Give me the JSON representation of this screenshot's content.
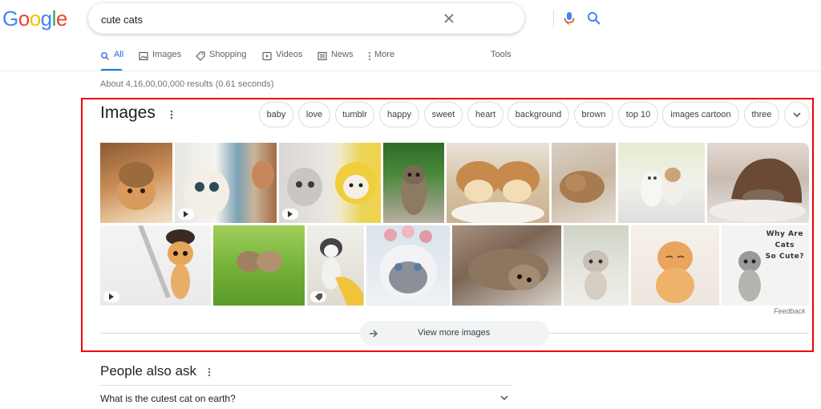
{
  "logo": {
    "letters": [
      "G",
      "o",
      "o",
      "g",
      "l",
      "e"
    ],
    "colors": [
      "#4285F4",
      "#EA4335",
      "#FBBC05",
      "#4285F4",
      "#34A853",
      "#EA4335"
    ]
  },
  "search": {
    "value": "cute cats",
    "icons": [
      "close-icon",
      "mic-icon",
      "search-icon"
    ]
  },
  "tabs": [
    {
      "label": "All",
      "icon": "search-icon"
    },
    {
      "label": "Images",
      "icon": "image-icon"
    },
    {
      "label": "Shopping",
      "icon": "tag-icon"
    },
    {
      "label": "Videos",
      "icon": "play-icon"
    },
    {
      "label": "News",
      "icon": "news-icon"
    },
    {
      "label": "More",
      "icon": "more-vert-icon"
    }
  ],
  "tools_label": "Tools",
  "result_stats": "About 4,16,00,00,000 results (0.61 seconds)",
  "images_section": {
    "title": "Images",
    "chips": [
      "baby",
      "love",
      "tumblr",
      "happy",
      "sweet",
      "heart",
      "background",
      "brown",
      "top 10",
      "images cartoon",
      "three"
    ],
    "thumb_overlay_text": [
      "Why Are",
      "Cats",
      "So Cute?"
    ],
    "feedback": "Feedback",
    "view_more": "View more images"
  },
  "people_also_ask": {
    "title": "People also ask",
    "question": "What is the cutest cat on earth?"
  },
  "colors": {
    "accent": "#1a73e8",
    "highlight_border": "#ee0000"
  }
}
